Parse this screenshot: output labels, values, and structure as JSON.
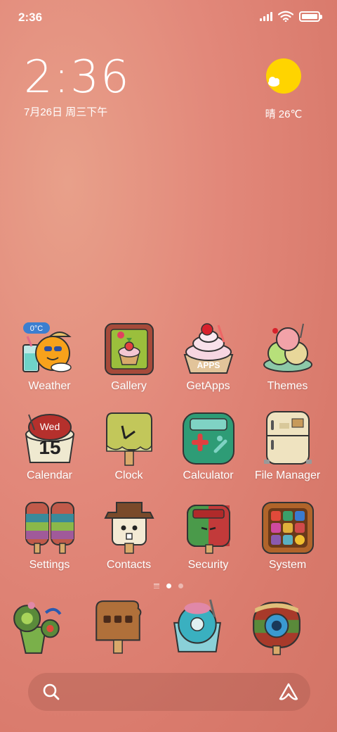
{
  "status_bar": {
    "time": "2:36",
    "icons": [
      "signal-icon",
      "wifi-icon",
      "battery-icon"
    ],
    "battery_level": 1.0
  },
  "clock_widget": {
    "time": "2:36",
    "date": "7月26日 周三下午"
  },
  "weather_widget": {
    "icon": "sun-cloud-icon",
    "text": "晴 26℃"
  },
  "apps": [
    {
      "label": "Weather",
      "icon": "weather-icon",
      "badge": "0°C"
    },
    {
      "label": "Gallery",
      "icon": "gallery-icon"
    },
    {
      "label": "GetApps",
      "icon": "getapps-icon",
      "badge": "APPS"
    },
    {
      "label": "Themes",
      "icon": "themes-icon"
    },
    {
      "label": "Calendar",
      "icon": "calendar-icon",
      "day": "Wed",
      "date": "15"
    },
    {
      "label": "Clock",
      "icon": "clock-icon"
    },
    {
      "label": "Calculator",
      "icon": "calculator-icon"
    },
    {
      "label": "File Manager",
      "icon": "file-manager-icon"
    },
    {
      "label": "Settings",
      "icon": "settings-icon"
    },
    {
      "label": "Contacts",
      "icon": "contacts-icon"
    },
    {
      "label": "Security",
      "icon": "security-icon"
    },
    {
      "label": "System",
      "icon": "system-icon"
    }
  ],
  "page_indicator": {
    "pages": 2,
    "active": 1
  },
  "dock": [
    {
      "icon": "phone-cactus-icon"
    },
    {
      "icon": "messages-icon"
    },
    {
      "icon": "browser-icon"
    },
    {
      "icon": "camera-icon"
    }
  ],
  "search_bar": {
    "left_icon": "search-icon",
    "right_icon": "assistant-icon"
  },
  "colors": {
    "background": "#e2887a",
    "text": "#ffffff",
    "sun": "#ffd400"
  }
}
